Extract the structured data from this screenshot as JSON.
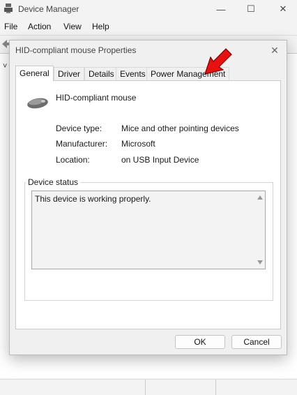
{
  "device_manager": {
    "title": "Device Manager",
    "menu": [
      "File",
      "Action",
      "View",
      "Help"
    ],
    "window_controls": {
      "minimize": "—",
      "maximize": "☐",
      "close": "✕"
    },
    "tree_glyph": "˅"
  },
  "dialog": {
    "title": "HID-compliant mouse Properties",
    "close_glyph": "✕",
    "tabs": [
      "General",
      "Driver",
      "Details",
      "Events",
      "Power Management"
    ],
    "active_tab": "General",
    "device_name": "HID-compliant mouse",
    "properties": {
      "device_type_label": "Device type:",
      "device_type_value": "Mice and other pointing devices",
      "manufacturer_label": "Manufacturer:",
      "manufacturer_value": "Microsoft",
      "location_label": "Location:",
      "location_value": "on USB Input Device"
    },
    "device_status": {
      "legend": "Device status",
      "text": "This device is working properly."
    },
    "buttons": {
      "ok": "OK",
      "cancel": "Cancel"
    }
  },
  "annotation": {
    "arrow_color": "#e81010",
    "points_to": "tab-power-management"
  }
}
